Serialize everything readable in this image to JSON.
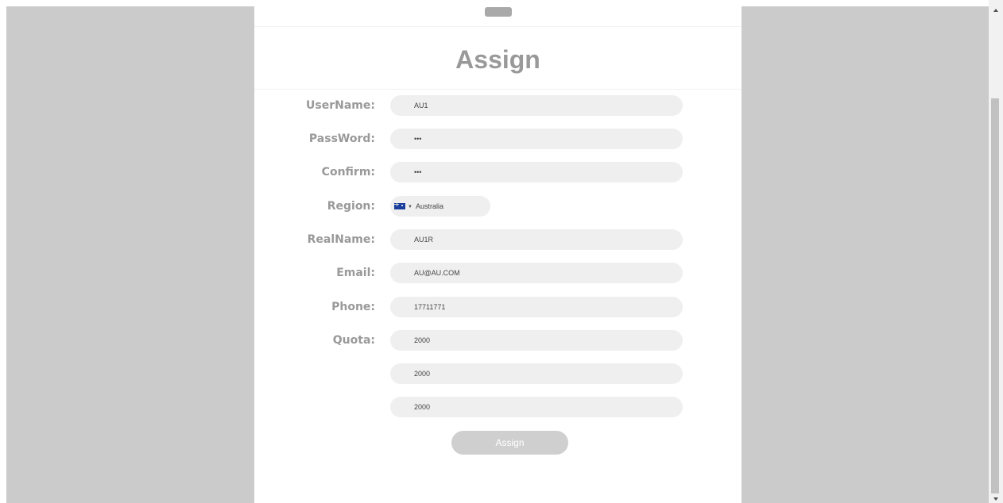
{
  "form": {
    "title": "Assign",
    "labels": {
      "username": "UserName:",
      "password": "PassWord:",
      "confirm": "Confirm:",
      "region": "Region:",
      "realname": "RealName:",
      "email": "Email:",
      "phone": "Phone:",
      "quota": "Quota:"
    },
    "values": {
      "username": "AU1",
      "password": "•••",
      "confirm": "•••",
      "region": "Australia",
      "realname": "AU1R",
      "email": "AU@AU.COM",
      "phone": "17711771",
      "quota": [
        "2000",
        "2000",
        "2000"
      ]
    },
    "submit_label": "Assign"
  },
  "icons": {
    "region_flag": "australia-flag-icon",
    "region_dropdown": "caret-down-icon"
  }
}
